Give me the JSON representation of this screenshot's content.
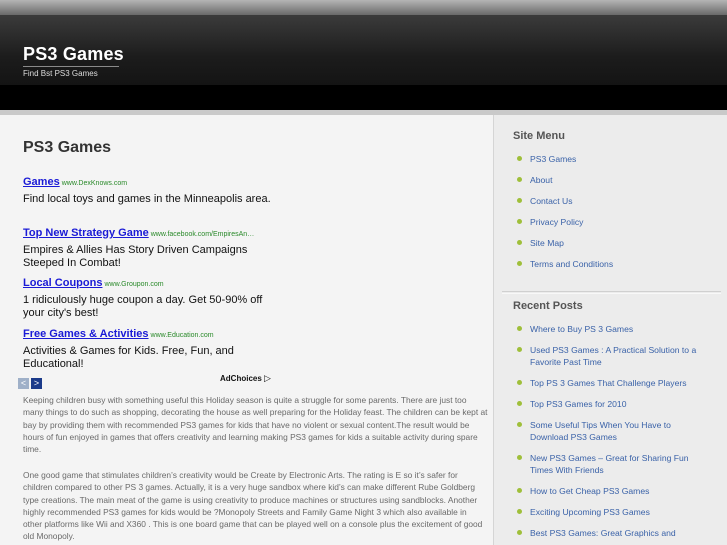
{
  "header": {
    "site_title": "PS3 Games",
    "tagline": "Find Bst PS3 Games"
  },
  "main": {
    "page_title": "PS3 Games",
    "ads": [
      {
        "title": "Games",
        "url": "www.DexKnows.com",
        "desc": "Find local toys and games in the Minneapolis area."
      },
      {
        "title": "Top New Strategy Game",
        "url": "www.facebook.com/EmpiresAn…",
        "desc": "Empires & Allies Has Story Driven Campaigns Steeped In Combat!"
      },
      {
        "title": "Local Coupons",
        "url": "www.Groupon.com",
        "desc": "1 ridiculously huge coupon a day. Get 50-90% off your city's best!"
      },
      {
        "title": "Free Games & Activities",
        "url": "www.Education.com",
        "desc": "Activities & Games for Kids. Free, Fun, and Educational!"
      }
    ],
    "ad_nav": {
      "prev": "<",
      "next": ">"
    },
    "adchoices_label": "AdChoices",
    "adchoices_icon": "▷",
    "paragraphs": [
      "Keeping children busy with something useful this Holiday season is quite a struggle for some parents. There are just too many things to do such as shopping, decorating the house as well preparing for the Holiday feast. The children can be kept at bay by providing them with recommended PS3 games for kids that have no violent or sexual content.The result would be hours of fun enjoyed in games that  offers creativity and learning making PS3 games for kids a suitable activity during spare time.",
      "One good game that stimulates children’s creativity would be Create by Electronic Arts. The rating is E so it’s safer for children compared to other PS 3 games. Actually, it is a very huge sandbox where kid’s can make different Rube Goldberg type creations. The main meat of the game is using creativity to produce machines or structures using sandblocks. Another highly recommended PS3 games for kids would be ?Monopoly Streets and Family Game Night 3 which also available in other platforms like Wii and X360 . This is one board game that can be played well on a console plus the excitement of good old Monopoly."
    ]
  },
  "sidebar": {
    "site_menu": {
      "heading": "Site Menu",
      "items": [
        "PS3 Games",
        "About",
        "Contact Us",
        "Privacy Policy",
        "Site Map",
        "Terms and Conditions"
      ]
    },
    "recent_posts": {
      "heading": "Recent Posts",
      "items": [
        "Where to Buy PS 3 Games",
        "Used PS3 Games : A Practical Solution to a Favorite Past Time",
        "Top PS 3 Games That Challenge Players",
        "Top PS3 Games for 2010",
        "Some Useful Tips When You Have to Download PS3 Games",
        "New PS3 Games – Great for Sharing Fun Times With Friends",
        "How to Get Cheap PS3 Games",
        "Exciting Upcoming PS3 Games",
        "Best PS3 Games: Great Graphics and"
      ]
    }
  },
  "colors": {
    "link": "#3a62a8",
    "ad_title": "#1a1ad6",
    "ad_url": "#2a8a2a",
    "bullet": "#9fbf3a"
  }
}
